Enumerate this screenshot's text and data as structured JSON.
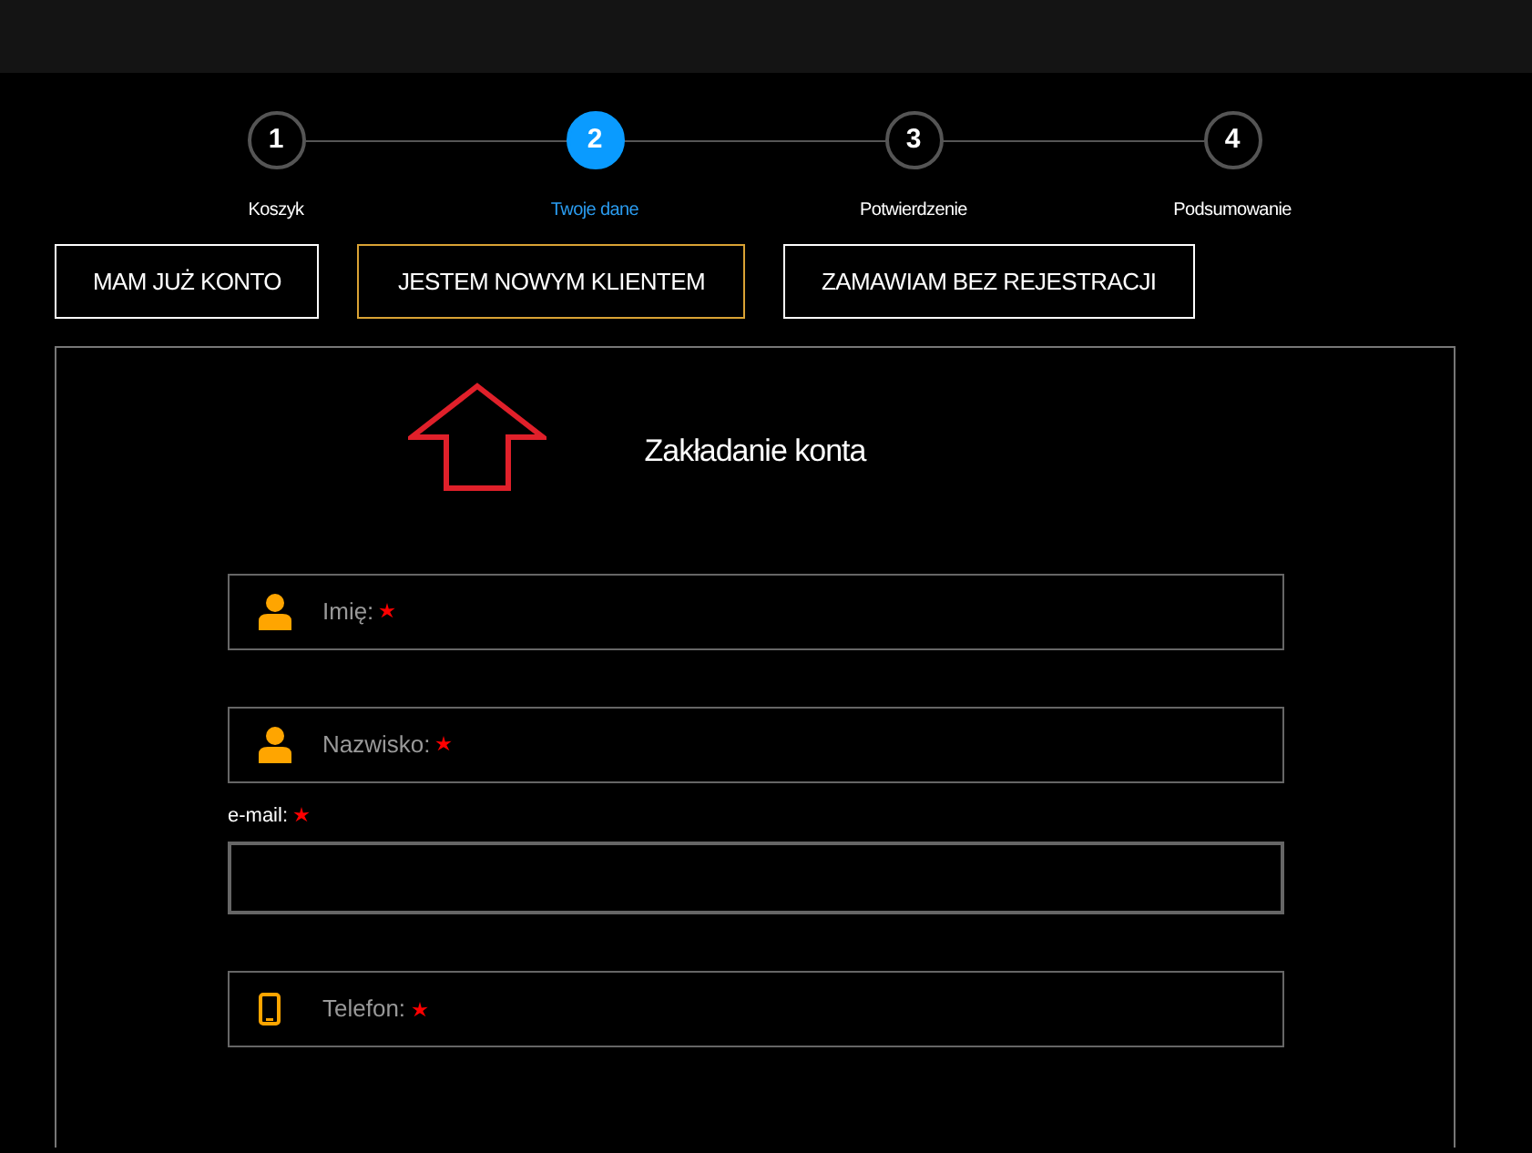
{
  "steps": [
    {
      "number": "1",
      "label": "Koszyk",
      "selected": false
    },
    {
      "number": "2",
      "label": "Twoje dane",
      "selected": true
    },
    {
      "number": "3",
      "label": "Potwierdzenie",
      "selected": false
    },
    {
      "number": "4",
      "label": "Podsumowanie",
      "selected": false
    }
  ],
  "tabs": [
    {
      "label": "MAM JUŻ KONTO",
      "selected": false
    },
    {
      "label": "JESTEM NOWYM KLIENTEM",
      "selected": true
    },
    {
      "label": "ZAMAWIAM BEZ REJESTRACJI",
      "selected": false
    }
  ],
  "form": {
    "title": "Zakładanie konta",
    "fields": [
      {
        "kind": "person",
        "placeholder": "Imię:",
        "required": true
      },
      {
        "kind": "person",
        "placeholder": "Nazwisko:",
        "required": true
      },
      {
        "kind": "labeled",
        "label": "e-mail:",
        "required": true
      },
      {
        "kind": "phone",
        "placeholder": "Telefon:",
        "required": true
      }
    ]
  }
}
